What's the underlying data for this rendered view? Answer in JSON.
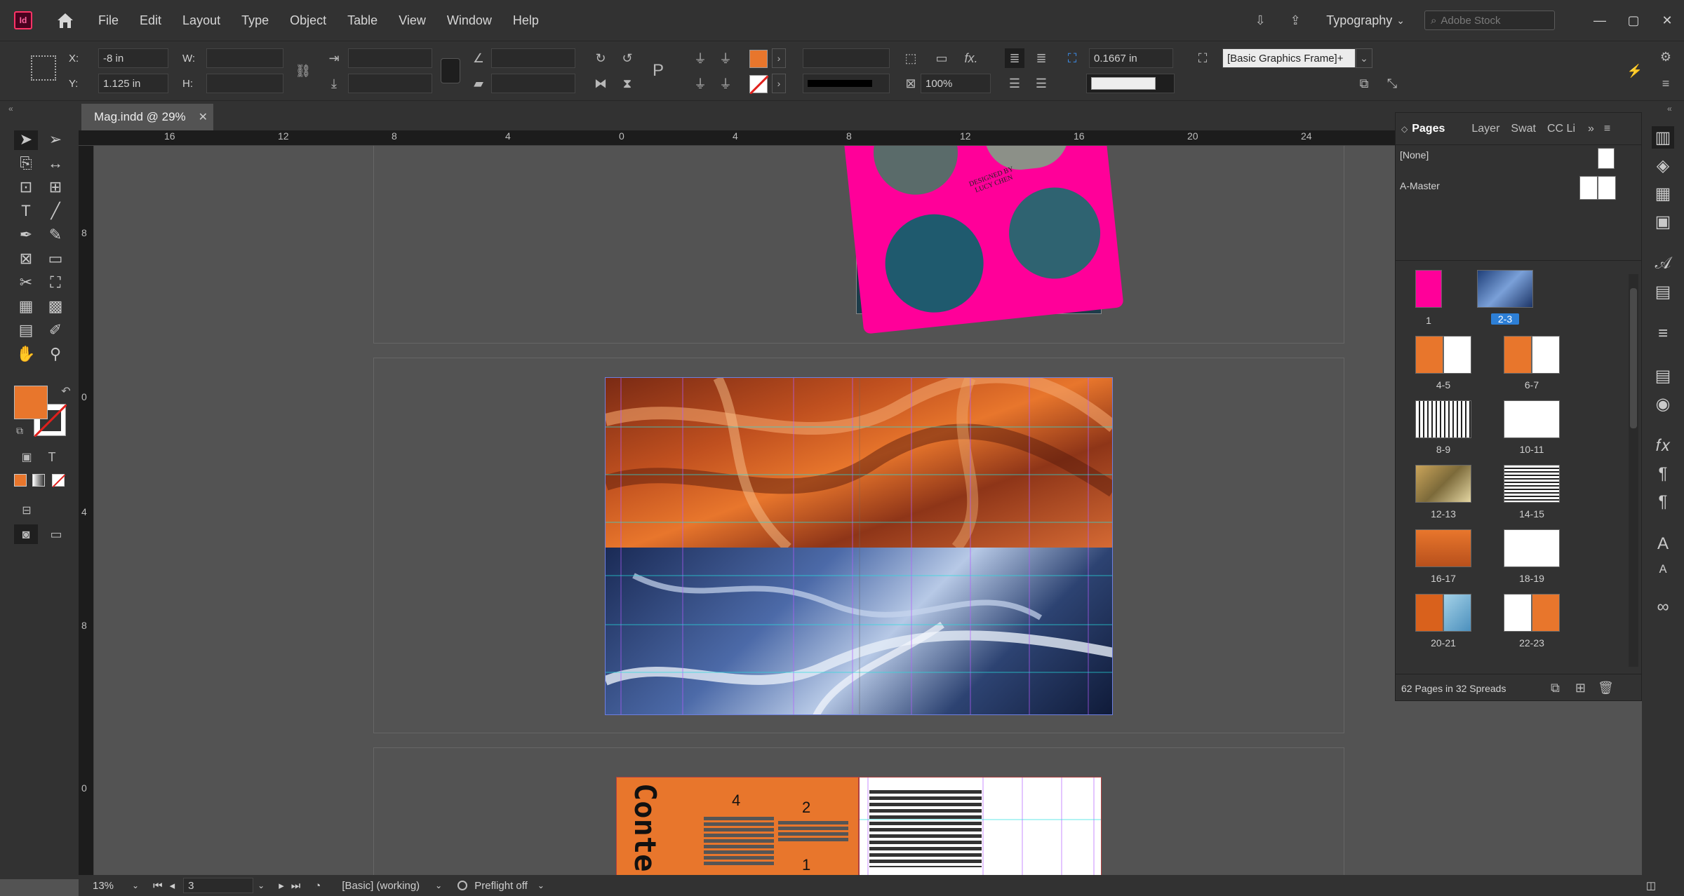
{
  "app": {
    "logo": "Id",
    "home_icon": "home-icon"
  },
  "menu": [
    "File",
    "Edit",
    "Layout",
    "Type",
    "Object",
    "Table",
    "View",
    "Window",
    "Help"
  ],
  "workspace": "Typography",
  "stock_placeholder": "Adobe Stock",
  "control": {
    "x_label": "X:",
    "x_value": "-8 in",
    "y_label": "Y:",
    "y_value": "1.125 in",
    "w_label": "W:",
    "h_label": "H:",
    "stroke_weight": "0.1667 in",
    "opacity": "100%",
    "object_style": "[Basic Graphics Frame]+",
    "fill_color": "#e8762c"
  },
  "document_tab": {
    "title": "Mag.indd @ 29%",
    "close": "✕"
  },
  "ruler_h": [
    "16",
    "12",
    "8",
    "4",
    "0",
    "4",
    "8",
    "12",
    "16",
    "20",
    "24"
  ],
  "ruler_v": [
    "8",
    "0",
    "4",
    "8",
    "0"
  ],
  "pages_panel": {
    "tabs": [
      "Pages",
      "Layer",
      "Swat",
      "CC Li"
    ],
    "masters": [
      "[None]",
      "A-Master"
    ],
    "spreads": [
      "1",
      "2-3",
      "4-5",
      "6-7",
      "8-9",
      "10-11",
      "12-13",
      "14-15",
      "16-17",
      "18-19",
      "20-21",
      "22-23"
    ],
    "footer": "62 Pages in 32 Spreads"
  },
  "page_artwork": {
    "cover_text": "DESIGNED BY LUCY CHEN",
    "contents_title": "Conte",
    "contents_numbers": [
      "4",
      "2",
      "1"
    ]
  },
  "status": {
    "zoom": "13%",
    "page": "3",
    "style": "[Basic] (working)",
    "preflight": "Preflight off"
  }
}
